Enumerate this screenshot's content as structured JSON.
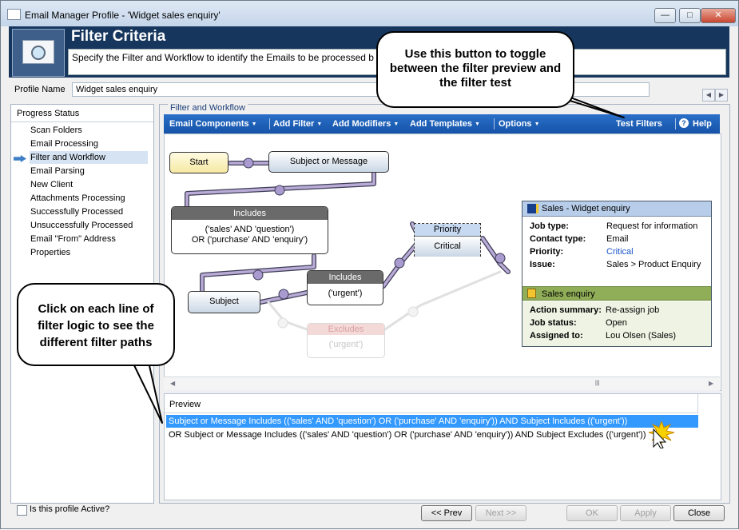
{
  "window": {
    "title": "Email Manager Profile - 'Widget sales enquiry'"
  },
  "header": {
    "title": "Filter Criteria",
    "description": "Specify the Filter and Workflow to identify the Emails to be processed b"
  },
  "profile": {
    "label": "Profile Name",
    "value": "Widget sales enquiry"
  },
  "progress": {
    "title": "Progress Status",
    "items": [
      "Scan Folders",
      "Email Processing",
      "Filter and Workflow",
      "Email Parsing",
      "New Client",
      "Attachments Processing",
      "Successfully Processed",
      "Unsuccessfully Processed",
      "Email \"From\" Address",
      "Properties"
    ],
    "selected": "Filter and Workflow"
  },
  "workflow": {
    "group_label": "Filter and Workflow",
    "toolbar": {
      "email_components": "Email Components",
      "add_filter": "Add Filter",
      "add_modifiers": "Add Modifiers",
      "add_templates": "Add Templates",
      "options": "Options",
      "test_filters": "Test Filters",
      "help": "Help"
    },
    "nodes": {
      "start": "Start",
      "subject_or_message": "Subject or Message",
      "includes1_header": "Includes",
      "includes1_line1": "('sales' AND 'question')",
      "includes1_line2": "OR ('purchase' AND 'enquiry')",
      "subject": "Subject",
      "includes2_header": "Includes",
      "includes2_body": "('urgent')",
      "excludes_header": "Excludes",
      "excludes_body": "('urgent')",
      "priority_header": "Priority",
      "priority_value": "Critical"
    },
    "card": {
      "title": "Sales - Widget enquiry",
      "fields": [
        {
          "key": "Job type:",
          "value": "Request for information"
        },
        {
          "key": "Contact type:",
          "value": "Email"
        },
        {
          "key": "Priority:",
          "value": "Critical"
        },
        {
          "key": "Issue:",
          "value": "Sales > Product Enquiry"
        }
      ],
      "section2_title": "Sales enquiry",
      "fields2": [
        {
          "key": "Action summary:",
          "value": "Re-assign job"
        },
        {
          "key": "Job status:",
          "value": "Open"
        },
        {
          "key": "Assigned to:",
          "value": "Lou Olsen (Sales)"
        }
      ]
    }
  },
  "preview": {
    "header": "Preview",
    "rows": [
      "Subject or Message Includes (('sales' AND 'question') OR ('purchase' AND 'enquiry')) AND Subject Includes (('urgent'))",
      "OR Subject or Message Includes (('sales' AND 'question') OR ('purchase' AND 'enquiry')) AND Subject Excludes (('urgent'))"
    ],
    "selected_index": 0
  },
  "callouts": {
    "toggle": "Use this button to toggle between the filter preview and the filter test",
    "click": "Click on each line of filter logic to see the different filter paths"
  },
  "footer": {
    "active_label": "Is this profile Active?",
    "prev": "<< Prev",
    "next": "Next >>",
    "ok": "OK",
    "apply": "Apply",
    "close": "Close"
  },
  "colors": {
    "toolbar": "#1553a8",
    "header": "#16365e",
    "selection": "#3399ff",
    "link": "#1a54c7"
  }
}
